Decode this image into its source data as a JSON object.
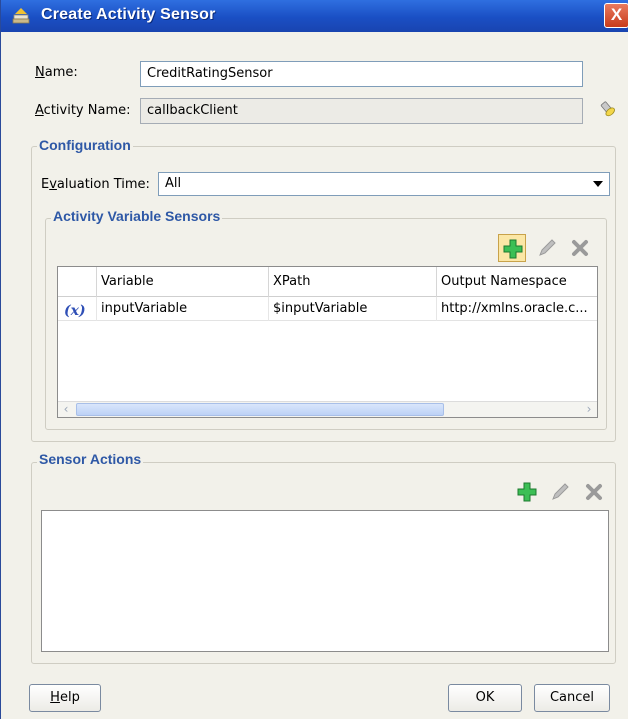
{
  "window": {
    "title": "Create Activity Sensor",
    "close_glyph": "X"
  },
  "form": {
    "name_label": "Name:",
    "name_mnemonic": "N",
    "name_label_rest": "ame:",
    "name_value": "CreditRatingSensor",
    "activity_label_mnemonic": "A",
    "activity_label_rest": "ctivity Name:",
    "activity_value": "callbackClient"
  },
  "configuration": {
    "title": "Configuration",
    "eval_label_start": "E",
    "eval_label_mnemonic": "v",
    "eval_label_rest": "aluation Time:",
    "eval_value": "All"
  },
  "activity_variable_sensors": {
    "title": "Activity Variable Sensors",
    "columns": [
      "Variable",
      "XPath",
      "Output Namespace"
    ],
    "rows": [
      {
        "icon": "(x)",
        "variable": "inputVariable",
        "xpath": "$inputVariable",
        "namespace": "http://xmlns.oracle.c..."
      }
    ]
  },
  "sensor_actions": {
    "title": "Sensor Actions"
  },
  "buttons": {
    "help_mnemonic": "H",
    "help_rest": "elp",
    "ok": "OK",
    "cancel": "Cancel"
  },
  "colors": {
    "titlebar": "#1a4fc4",
    "group_title": "#2e58a6",
    "add_green": "#2fa84a",
    "dialog_bg": "#f2f1ea"
  }
}
